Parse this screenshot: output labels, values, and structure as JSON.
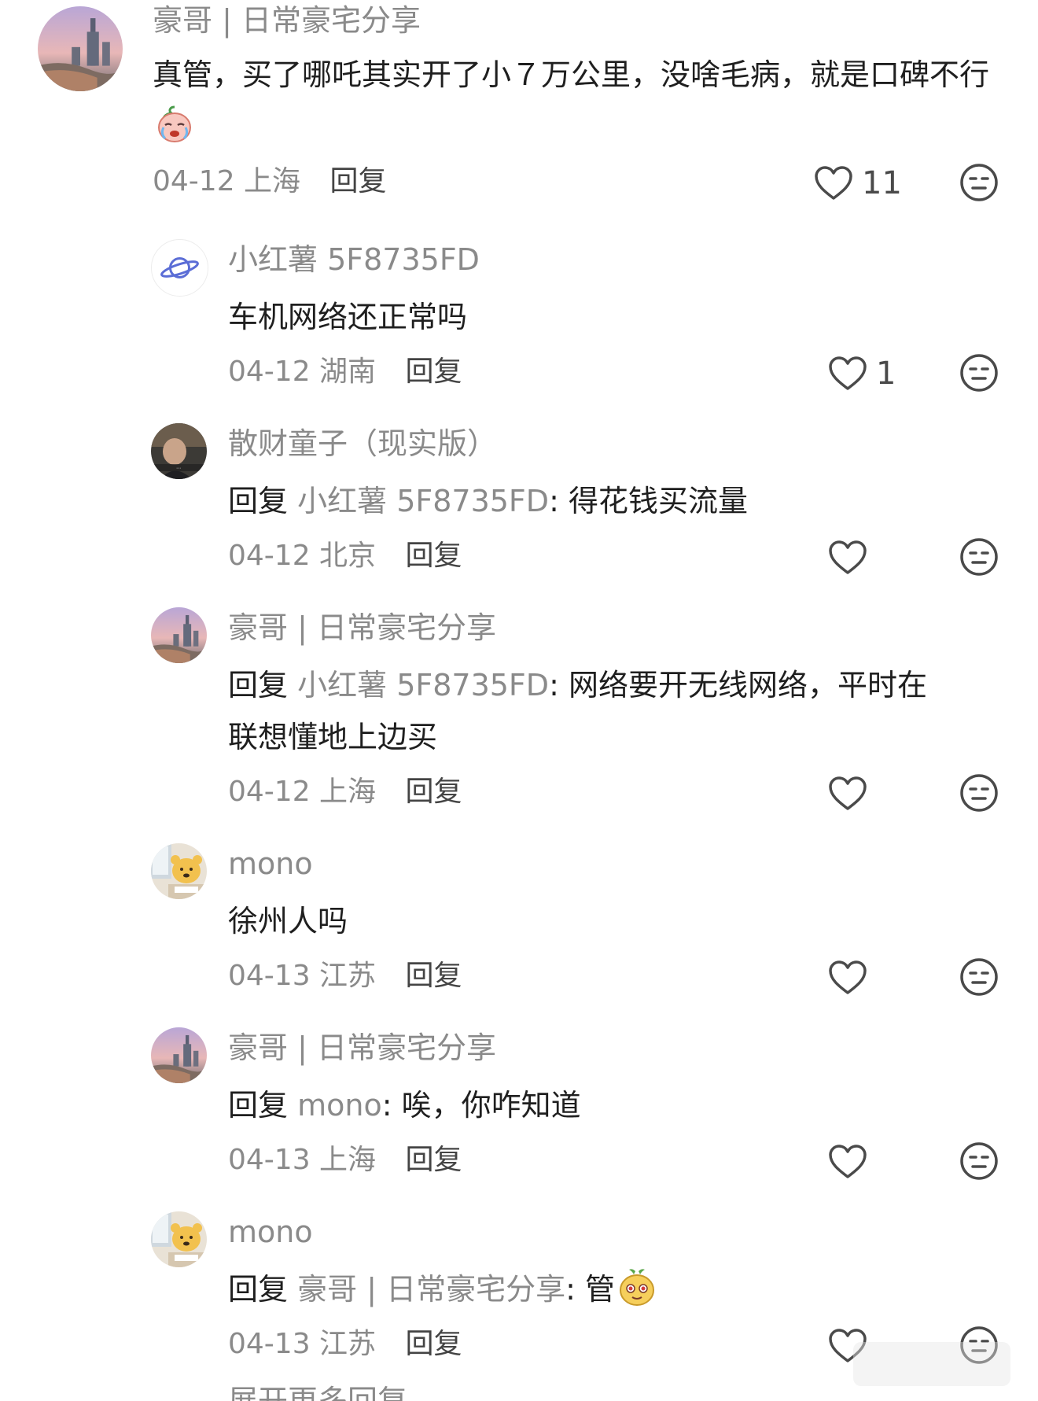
{
  "comments": [
    {
      "author": "豪哥 | 日常豪宅分享",
      "text": "真管，买了哪吒其实开了小７万公里，没啥毛病，就是口碑不行",
      "emoji": "crying-face-emoji",
      "date_location": "04-12 上海",
      "reply_label": "回复",
      "likes": "11"
    },
    {
      "author": "小红薯 5F8735FD",
      "text": "车机网络还正常吗",
      "date_location": "04-12 湖南",
      "reply_label": "回复",
      "likes": "1"
    },
    {
      "author": "散财童子（现实版）",
      "reply_prefix": "回复",
      "mention": "小红薯 5F8735FD",
      "text": ": 得花钱买流量",
      "date_location": "04-12 北京",
      "reply_label": "回复",
      "likes": ""
    },
    {
      "author": "豪哥 | 日常豪宅分享",
      "reply_prefix": "回复",
      "mention": "小红薯 5F8735FD",
      "text": ": 网络要开无线网络，平时在",
      "text_line2": "联想懂地上边买",
      "date_location": "04-12 上海",
      "reply_label": "回复",
      "likes": ""
    },
    {
      "author": "mono",
      "text": "徐州人吗",
      "date_location": "04-13 江苏",
      "reply_label": "回复",
      "likes": ""
    },
    {
      "author": "豪哥 | 日常豪宅分享",
      "reply_prefix": "回复",
      "mention": "mono",
      "text": ": 唉，你咋知道",
      "date_location": "04-13 上海",
      "reply_label": "回复",
      "likes": ""
    },
    {
      "author": "mono",
      "reply_prefix": "回复",
      "mention": "豪哥 | 日常豪宅分享",
      "text": ": 管",
      "emoji": "potato-face-emoji",
      "date_location": "04-13 江苏",
      "reply_label": "回复",
      "likes": ""
    }
  ],
  "more_replies": "展开更多回复",
  "colors": {
    "secondary_text": "#8a8a8a",
    "primary_text": "#1f1f1f",
    "icon": "#4a4a4a"
  },
  "icons": [
    "heart-outline-icon",
    "dislike-face-icon"
  ]
}
